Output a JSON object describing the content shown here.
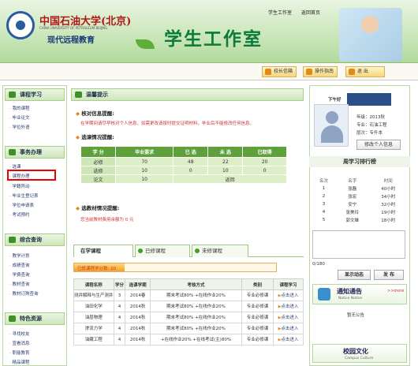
{
  "header": {
    "uni_name": "中国石油大学(北京)",
    "uni_en": "CHINA UNIVERSITY OF PETROLEUM BEIJING",
    "uni_sub": "现代远程教育",
    "banner_title": "学生工作室",
    "top_links": [
      "学生工作室",
      "返回首页"
    ]
  },
  "toolbar": {
    "mailbox": "校长信箱",
    "guide": "操作指南",
    "exit": "退 出"
  },
  "left": {
    "course_title": "课程学习",
    "course_items": [
      "我的课程",
      "毕业论文",
      "学位外语"
    ],
    "affairs_title": "事务办理",
    "affairs_items": [
      "选课",
      "课程办理",
      "学籍异动",
      "毕业生登记表",
      "学位申请表",
      "考试预约"
    ],
    "query_title": "综合查询",
    "query_items": [
      "教学计划",
      "成绩查询",
      "学费查询",
      "教材查询",
      "教材订购查询"
    ],
    "special_title": "特色资源",
    "special_items": [
      "寻找校友",
      "宣看消息",
      "职能教育",
      "精品课程"
    ]
  },
  "main": {
    "notice_title": "温馨提示",
    "verify_title": "核对信息提醒:",
    "verify_note": "在学期间请尽早核对个人信息，如需更改请按时提交证明材料，毕业后不能修改任何信息。",
    "course_status_title": "选课情况提醒:",
    "stat_headers": [
      "学 分",
      "毕业要求",
      "已 选",
      "未 选",
      "已取得"
    ],
    "stat_rows": [
      [
        "必修",
        "70",
        "48",
        "22",
        "20"
      ],
      [
        "选修",
        "10",
        "0",
        "10",
        "0"
      ],
      [
        "论文",
        "10",
        "",
        "",
        ""
      ]
    ],
    "stat_note": "返回",
    "fee_title": "选教材情况提醒:",
    "fee_note": "您当前教材费用余额为 0 元",
    "tabs": [
      "在学课程",
      "已修课程",
      "未修课程"
    ],
    "progress_label": "已修课程学分数: 20",
    "progress_value": 0.25,
    "course_headers": [
      "课程名称",
      "学分",
      "选课学期",
      "考核方式",
      "类别",
      "课程学习"
    ],
    "course_rows": [
      [
        "测井解释与生产测井",
        "3",
        "2014春",
        "期末考试80% +在线作业20%",
        "专业必修课",
        "点击进入"
      ],
      [
        "油田化学",
        "4",
        "2014秋",
        "期末考试80% +在线作业20%",
        "专业必修课",
        "点击进入"
      ],
      [
        "油层物理",
        "4",
        "2014秋",
        "期末考试80% +在线作业20%",
        "专业必修课",
        "点击进入"
      ],
      [
        "渗流力学",
        "4",
        "2014秋",
        "期末考试80% +在线作业20%",
        "专业必修课",
        "点击进入"
      ],
      [
        "油藏工程",
        "4",
        "2014秋",
        "+在线作业20% +在线考试(主)80%",
        "专业必修课",
        "点击进入"
      ]
    ]
  },
  "right": {
    "greeting": "下午好",
    "grade": "年级：2013秋",
    "major": "专业：石油工程",
    "level": "层次：专升本",
    "edit_button": "修改个人信息",
    "rank_title": "周学习排行榜",
    "rank_headers": [
      "名次",
      "名字",
      "时间"
    ],
    "rank_rows": [
      [
        "1",
        "张磊",
        "40小时"
      ],
      [
        "2",
        "张宏",
        "34小时"
      ],
      [
        "3",
        "安宁",
        "32小时"
      ],
      [
        "4",
        "张美玲",
        "19小时"
      ],
      [
        "5",
        "郭文雄",
        "18小时"
      ]
    ],
    "char_count": "0/180",
    "show_button": "显示动态",
    "post_button": "发 布",
    "notice_block": "通知通告",
    "notice_en": "Notice Notice",
    "more": ">>more",
    "no_notice": "暂无公告",
    "culture_block": "校园文化",
    "culture_en": "Campus Culture"
  }
}
